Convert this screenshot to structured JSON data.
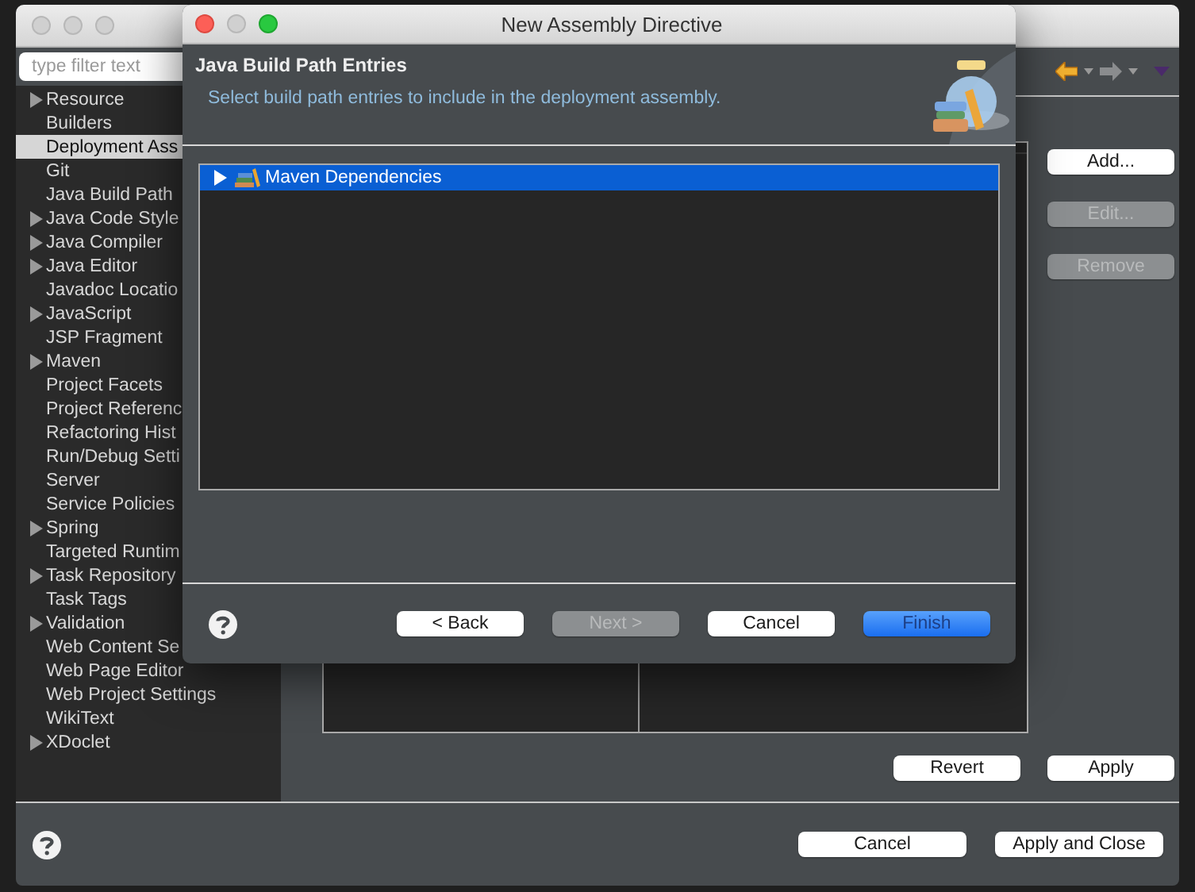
{
  "preferences": {
    "filter": {
      "placeholder": "type filter text"
    },
    "tree": [
      {
        "label": "Resource",
        "has_children": true,
        "selected": false
      },
      {
        "label": "Builders",
        "has_children": false,
        "selected": false
      },
      {
        "label": "Deployment Ass",
        "has_children": false,
        "selected": true
      },
      {
        "label": "Git",
        "has_children": false,
        "selected": false
      },
      {
        "label": "Java Build Path",
        "has_children": false,
        "selected": false
      },
      {
        "label": "Java Code Style",
        "has_children": true,
        "selected": false
      },
      {
        "label": "Java Compiler",
        "has_children": true,
        "selected": false
      },
      {
        "label": "Java Editor",
        "has_children": true,
        "selected": false
      },
      {
        "label": "Javadoc Locatio",
        "has_children": false,
        "selected": false
      },
      {
        "label": "JavaScript",
        "has_children": true,
        "selected": false
      },
      {
        "label": "JSP Fragment",
        "has_children": false,
        "selected": false
      },
      {
        "label": "Maven",
        "has_children": true,
        "selected": false
      },
      {
        "label": "Project Facets",
        "has_children": false,
        "selected": false
      },
      {
        "label": "Project Referenc",
        "has_children": false,
        "selected": false
      },
      {
        "label": "Refactoring Hist",
        "has_children": false,
        "selected": false
      },
      {
        "label": "Run/Debug Setti",
        "has_children": false,
        "selected": false
      },
      {
        "label": "Server",
        "has_children": false,
        "selected": false
      },
      {
        "label": "Service Policies",
        "has_children": false,
        "selected": false
      },
      {
        "label": "Spring",
        "has_children": true,
        "selected": false
      },
      {
        "label": "Targeted Runtim",
        "has_children": false,
        "selected": false
      },
      {
        "label": "Task Repository",
        "has_children": true,
        "selected": false
      },
      {
        "label": "Task Tags",
        "has_children": false,
        "selected": false
      },
      {
        "label": "Validation",
        "has_children": true,
        "selected": false
      },
      {
        "label": "Web Content Se",
        "has_children": false,
        "selected": false
      },
      {
        "label": "Web Page Editor",
        "has_children": false,
        "selected": false
      },
      {
        "label": "Web Project Settings",
        "has_children": false,
        "selected": false
      },
      {
        "label": "WikiText",
        "has_children": false,
        "selected": false
      },
      {
        "label": "XDoclet",
        "has_children": true,
        "selected": false
      }
    ],
    "side_buttons": [
      {
        "label": "Add...",
        "disabled": false
      },
      {
        "label": "Edit...",
        "disabled": true
      },
      {
        "label": "Remove",
        "disabled": true
      }
    ],
    "apply_buttons": [
      "Revert",
      "Apply"
    ],
    "footer_buttons": [
      "Cancel",
      "Apply and Close"
    ]
  },
  "dialog": {
    "title": "New Assembly Directive",
    "header": {
      "title": "Java Build Path Entries",
      "subtitle": "Select build path entries to include in the deployment assembly."
    },
    "entries": [
      {
        "label": "Maven Dependencies",
        "has_children": true,
        "selected": true
      }
    ],
    "buttons": [
      {
        "label": "< Back",
        "disabled": false,
        "primary": false
      },
      {
        "label": "Next >",
        "disabled": true,
        "primary": false
      },
      {
        "label": "Cancel",
        "disabled": false,
        "primary": false
      },
      {
        "label": "Finish",
        "disabled": false,
        "primary": true
      }
    ]
  }
}
